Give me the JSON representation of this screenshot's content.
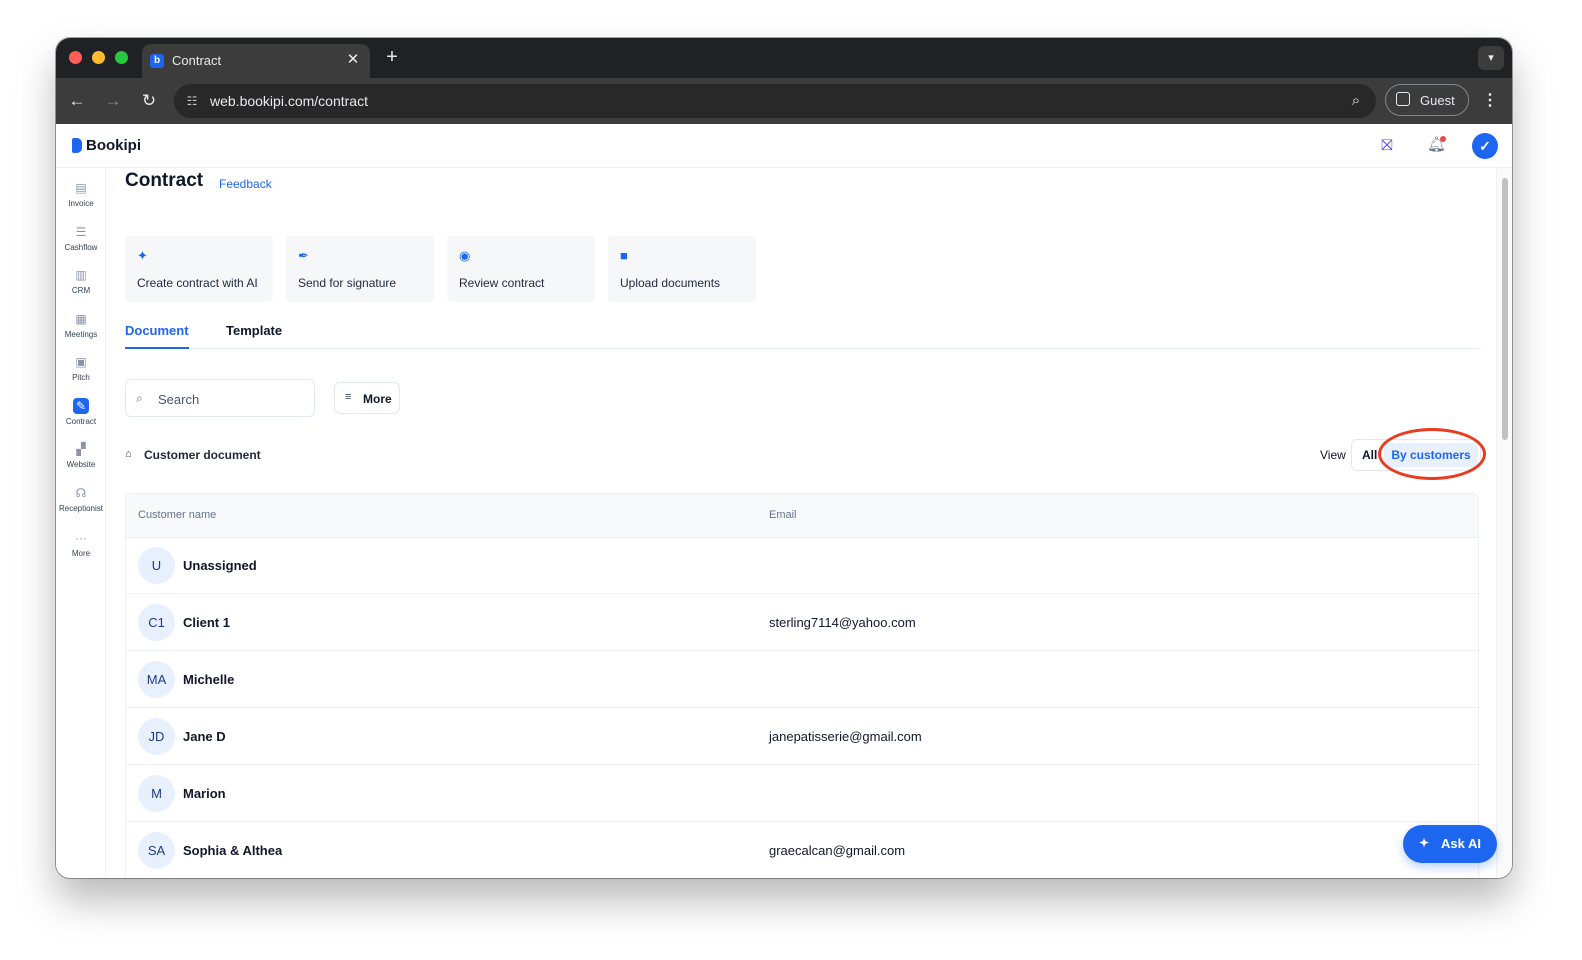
{
  "browser": {
    "tab_title": "Contract",
    "tab_favicon_glyph": "b",
    "url": "web.bookipi.com/contract",
    "profile_label": "Guest"
  },
  "app": {
    "brand": "Bookipi",
    "accent_color": "#1d66f0",
    "notification_dot_color": "#ef4444"
  },
  "sidebar": {
    "items": [
      {
        "label": "Invoice",
        "icon": "invoice-icon",
        "active": false
      },
      {
        "label": "Cashflow",
        "icon": "cashflow-icon",
        "active": false
      },
      {
        "label": "CRM",
        "icon": "crm-icon",
        "active": false
      },
      {
        "label": "Meetings",
        "icon": "meetings-icon",
        "active": false
      },
      {
        "label": "Pitch",
        "icon": "pitch-icon",
        "active": false
      },
      {
        "label": "Contract",
        "icon": "contract-icon",
        "active": true
      },
      {
        "label": "Website",
        "icon": "website-icon",
        "active": false
      },
      {
        "label": "Receptionist",
        "icon": "receptionist-icon",
        "active": false
      },
      {
        "label": "More",
        "icon": "more-dots-icon",
        "active": false
      }
    ]
  },
  "page": {
    "title": "Contract",
    "feedback": "Feedback"
  },
  "actions": [
    {
      "label": "Create contract with AI",
      "icon": "sparkle-icon"
    },
    {
      "label": "Send for signature",
      "icon": "pen-icon"
    },
    {
      "label": "Review contract",
      "icon": "eye-icon"
    },
    {
      "label": "Upload documents",
      "icon": "folder-icon"
    }
  ],
  "tabs": [
    {
      "label": "Document",
      "active": true
    },
    {
      "label": "Template",
      "active": false
    }
  ],
  "search": {
    "placeholder": "Search",
    "value": ""
  },
  "filter": {
    "label": "More"
  },
  "section": {
    "title": "Customer document"
  },
  "view": {
    "label": "View",
    "options": [
      "All",
      "By customers"
    ],
    "selected": "By customers"
  },
  "table": {
    "columns": [
      "Customer name",
      "Email"
    ],
    "rows": [
      {
        "initials": "U",
        "name": "Unassigned",
        "email": ""
      },
      {
        "initials": "C1",
        "name": "Client 1",
        "email": "sterling7114@yahoo.com"
      },
      {
        "initials": "MA",
        "name": "Michelle",
        "email": ""
      },
      {
        "initials": "JD",
        "name": "Jane D",
        "email": "janepatisserie@gmail.com"
      },
      {
        "initials": "M",
        "name": "Marion",
        "email": ""
      },
      {
        "initials": "SA",
        "name": "Sophia & Althea",
        "email": "graecalcan@gmail.com"
      }
    ]
  },
  "ask_ai": {
    "label": "Ask AI"
  }
}
